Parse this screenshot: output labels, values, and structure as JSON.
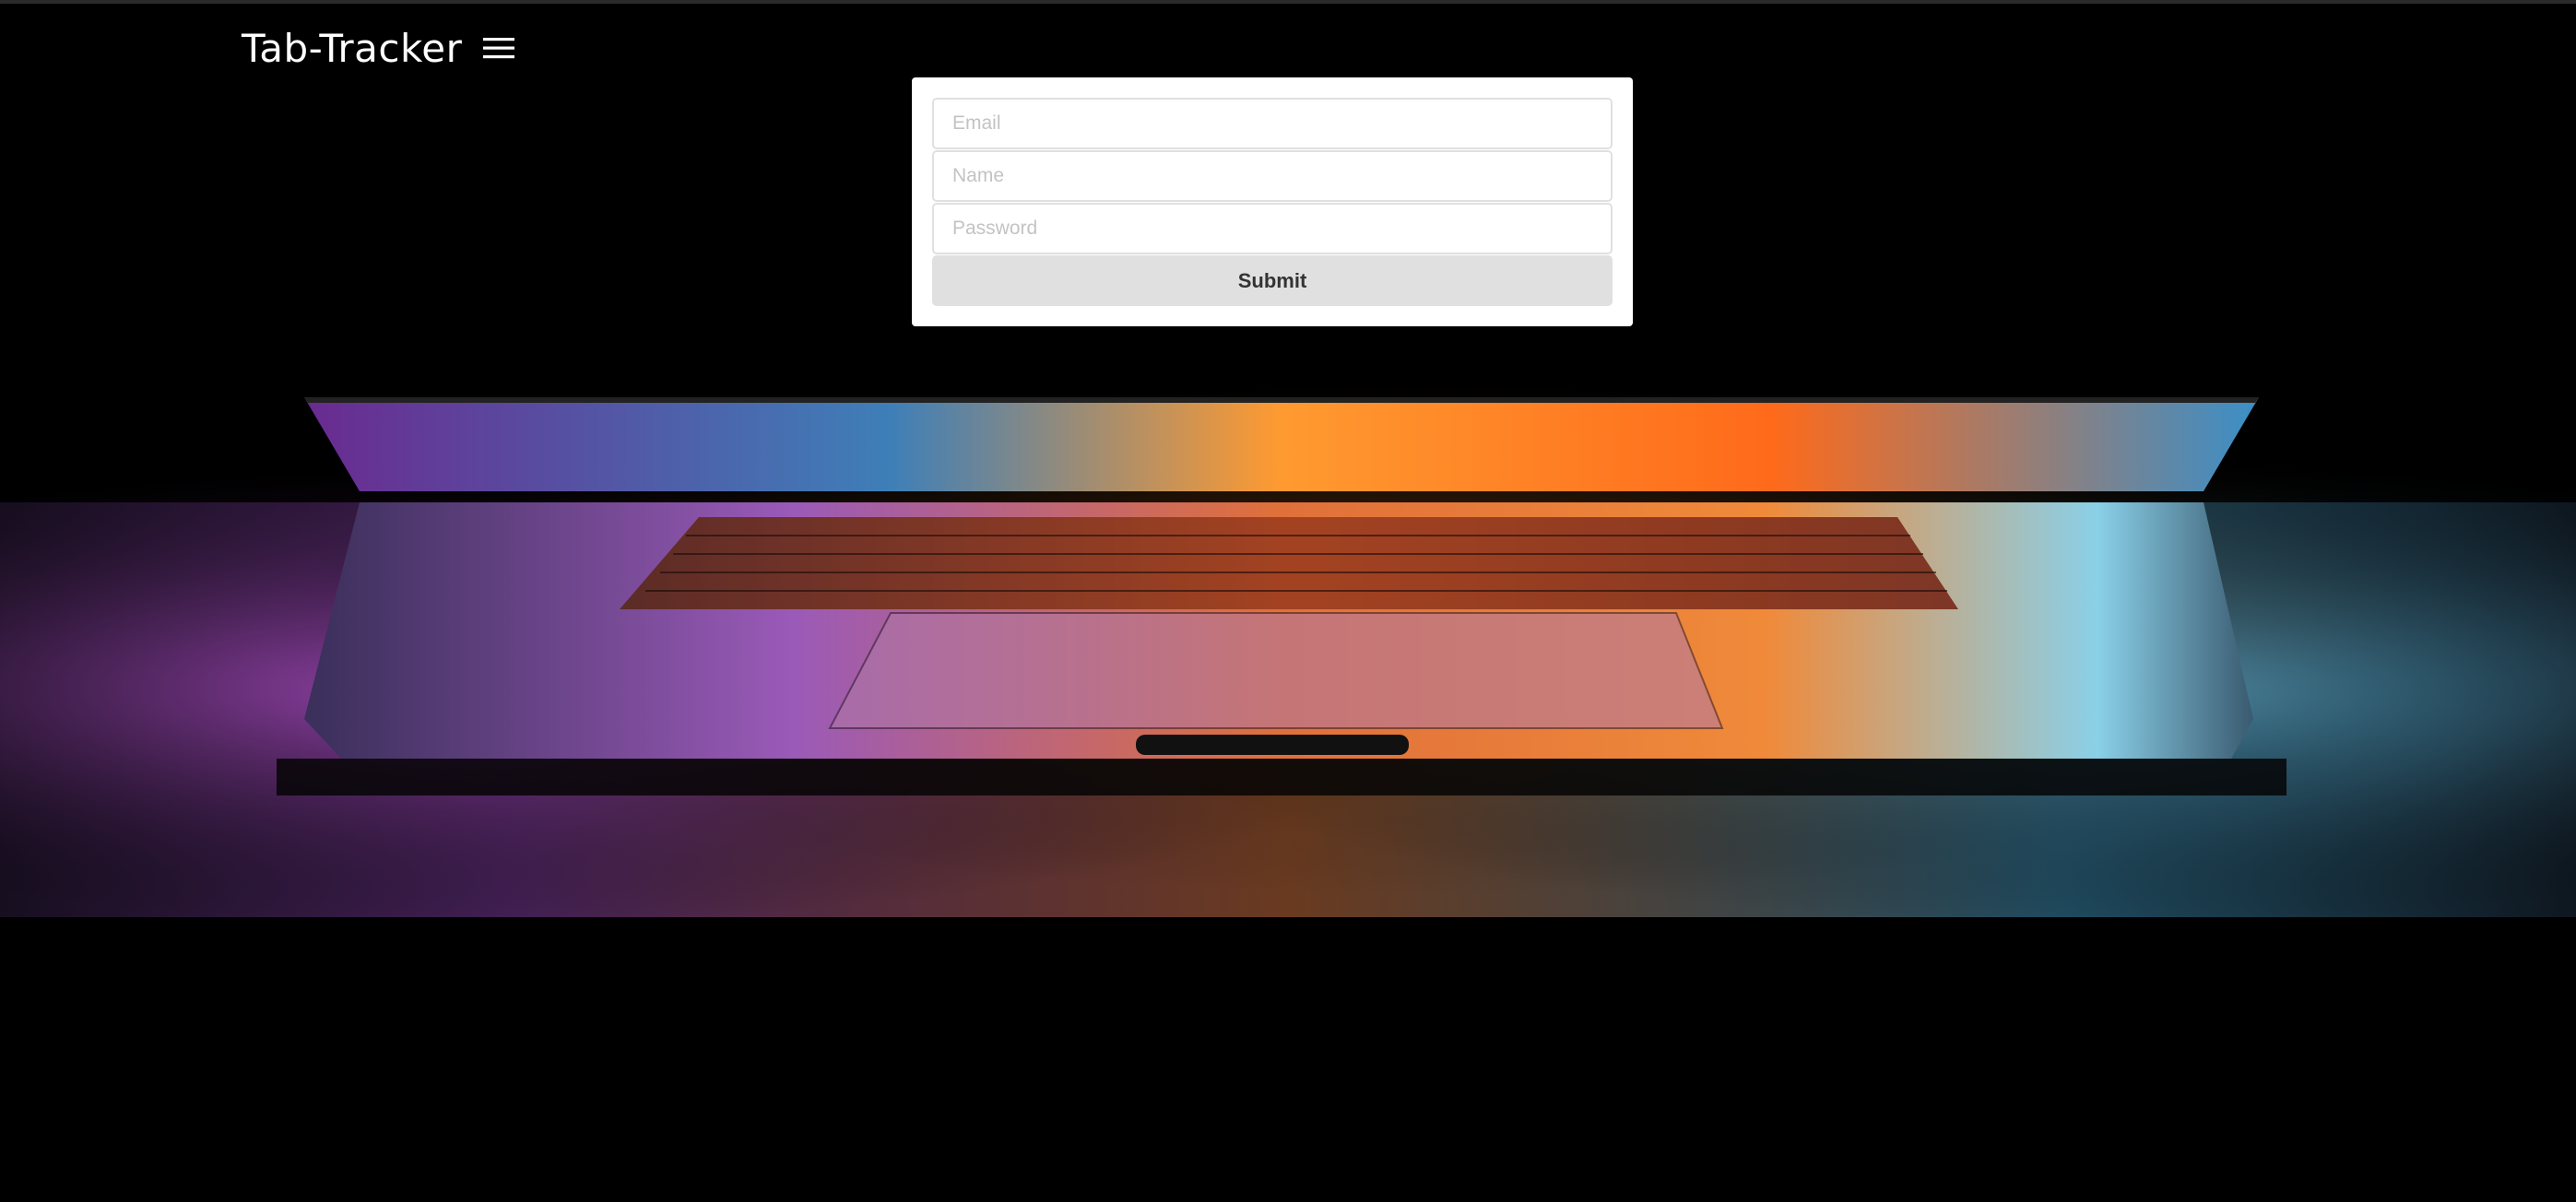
{
  "header": {
    "title": "Tab-Tracker",
    "menu_icon": "hamburger-menu-icon"
  },
  "form": {
    "email_placeholder": "Email",
    "name_placeholder": "Name",
    "password_placeholder": "Password",
    "submit_label": "Submit"
  },
  "hero": {
    "image": "laptop-photo",
    "accent_colors": [
      "#ff8a2a",
      "#c04fd0",
      "#4aa7d8",
      "#ffb347"
    ]
  }
}
